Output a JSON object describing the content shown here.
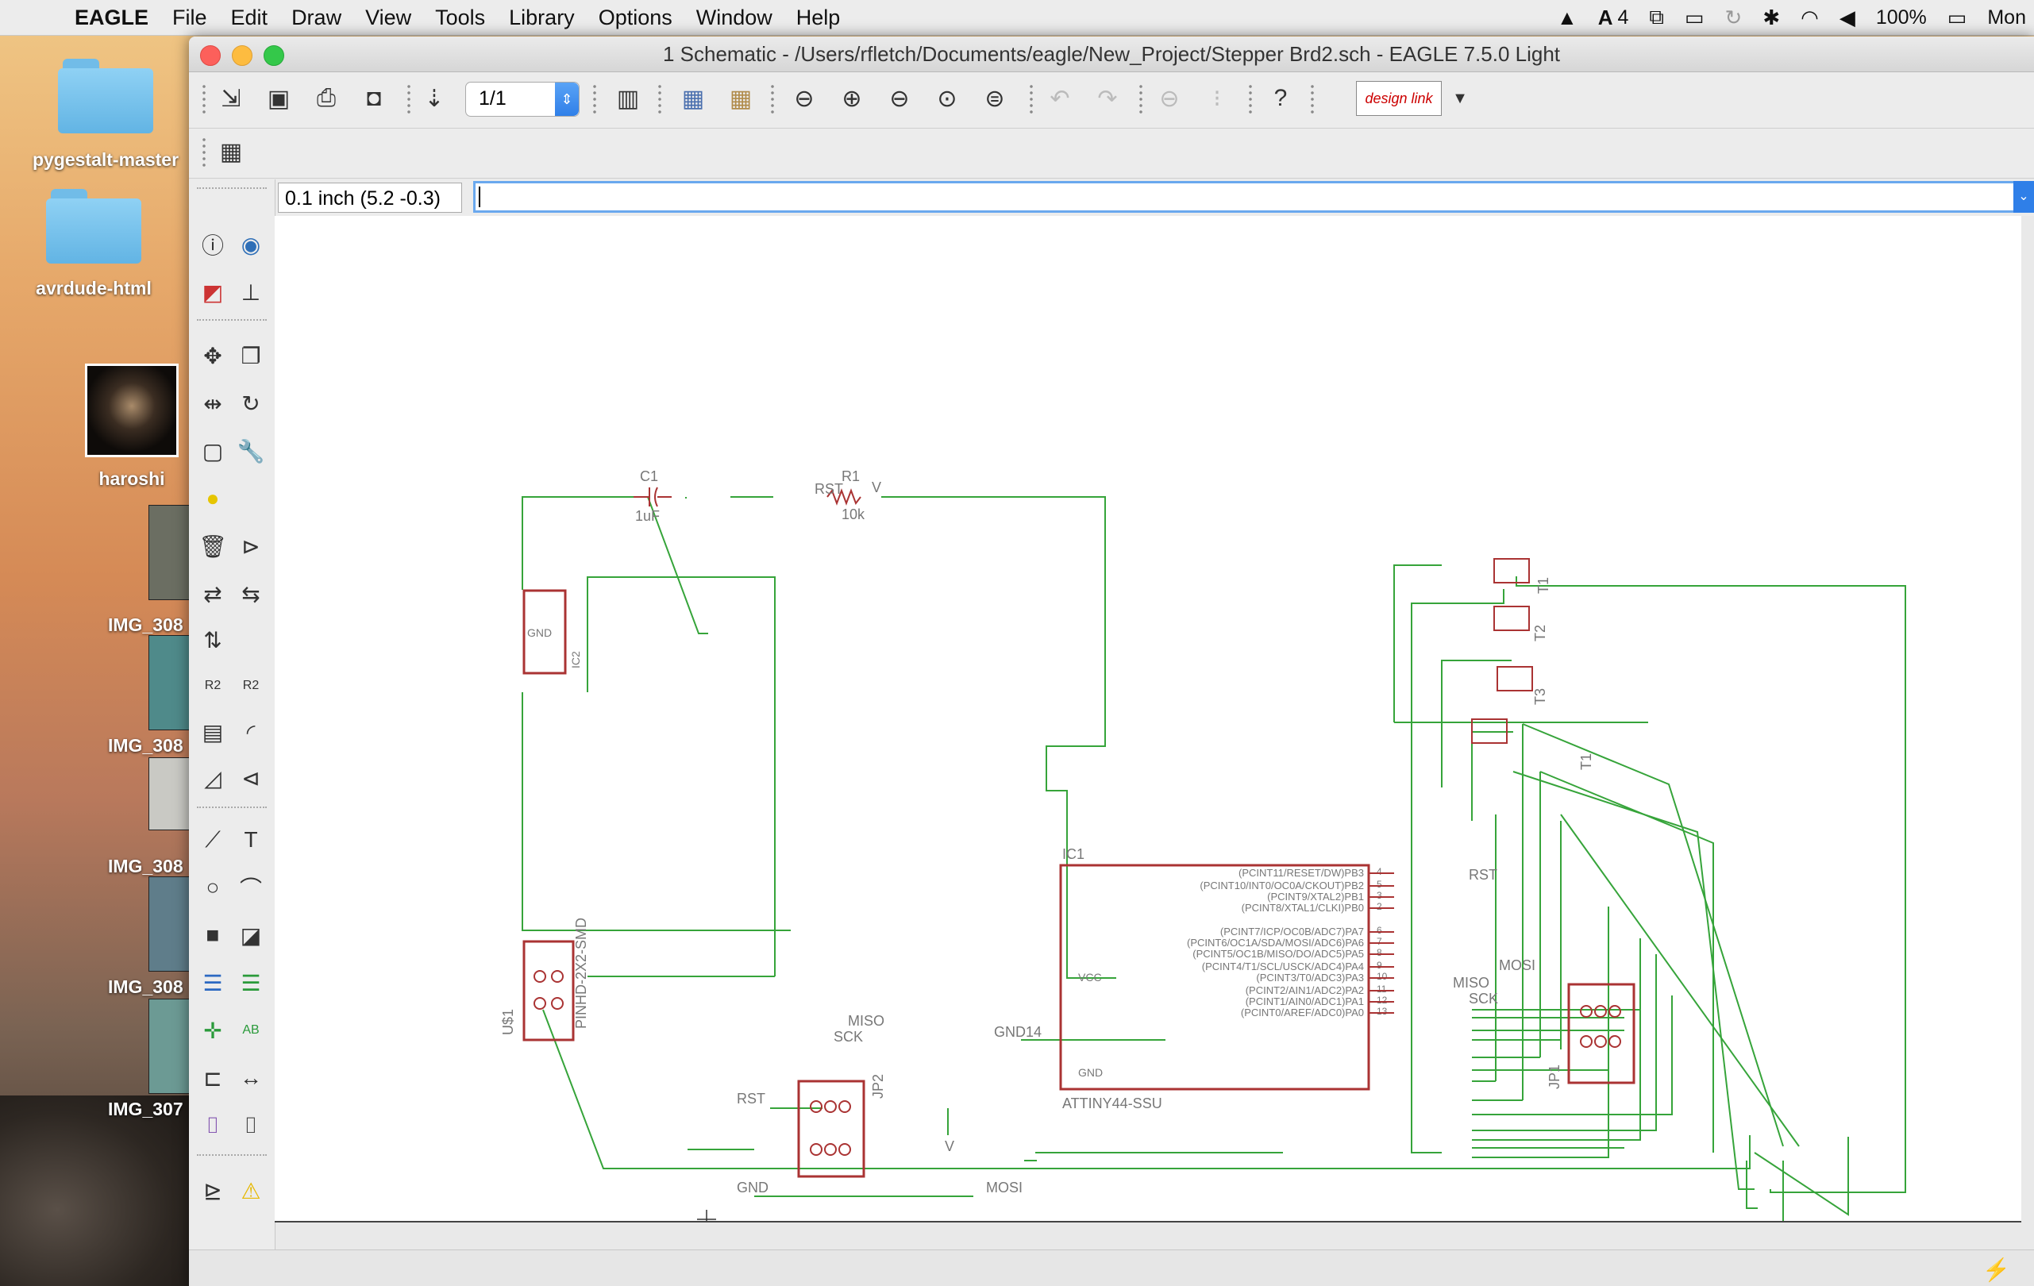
{
  "menubar": {
    "app_name": "EAGLE",
    "items": [
      "File",
      "Edit",
      "Draw",
      "View",
      "Tools",
      "Library",
      "Options",
      "Window",
      "Help"
    ],
    "status": {
      "adobe_count": "4",
      "battery": "100%",
      "clock": "Mon"
    }
  },
  "desktop": {
    "icons": [
      {
        "label": "pygestalt-master"
      },
      {
        "label": "avrdude-html"
      },
      {
        "label": "haroshi"
      }
    ],
    "thumbnails": [
      "IMG_308",
      "IMG_308",
      "IMG_308",
      "IMG_308",
      "IMG_307"
    ]
  },
  "window": {
    "title": "1 Schematic - /Users/rfletch/Documents/eagle/New_Project/Stepper Brd2.sch - EAGLE 7.5.0 Light",
    "sheet_selector": "1/1",
    "design_link_label": "design link",
    "coordinate_readout": "0.1 inch (5.2 -0.3)",
    "command_value": ""
  },
  "schematic": {
    "labels": {
      "c1_name": "C1",
      "c1_value": "1uF",
      "r1_name": "R1",
      "r1_value": "10k",
      "rst_top": "RST",
      "v_top": "V",
      "ic1_name": "IC1",
      "ic1_part": "ATTINY44-SSU",
      "vcc": "VCC",
      "gnd": "GND",
      "gnd14": "GND14",
      "u1": "U$1",
      "pinhd": "PINHD-2X2-SMD",
      "ic2": "IC2",
      "jp2": "JP2",
      "jp1": "JP1",
      "miso": "MISO",
      "sck": "SCK",
      "rst_jp2": "RST",
      "gnd_jp2": "GND",
      "mosi_jp2": "MOSI",
      "v_jp2": "V",
      "rst_right": "RST",
      "mosi_right": "MOSI",
      "miso_right": "MISO",
      "sck_right": "SCK",
      "t1": "T1",
      "t2": "T2",
      "t3": "T3",
      "t1b": "T1"
    },
    "ic1_pins": [
      {
        "name": "(PCINT11/RESET/DW)PB3",
        "num": "4"
      },
      {
        "name": "(PCINT10/INT0/OC0A/CKOUT)PB2",
        "num": "5"
      },
      {
        "name": "(PCINT9/XTAL2)PB1",
        "num": "3"
      },
      {
        "name": "(PCINT8/XTAL1/CLKI)PB0",
        "num": "2"
      },
      {
        "name": "(PCINT7/ICP/OC0B/ADC7)PA7",
        "num": "6"
      },
      {
        "name": "(PCINT6/OC1A/SDA/MOSI/ADC6)PA6",
        "num": "7"
      },
      {
        "name": "(PCINT5/OC1B/MISO/DO/ADC5)PA5",
        "num": "8"
      },
      {
        "name": "(PCINT4/T1/SCL/USCK/ADC4)PA4",
        "num": "9"
      },
      {
        "name": "(PCINT3/T0/ADC3)PA3",
        "num": "10"
      },
      {
        "name": "(PCINT2/AIN1/ADC2)PA2",
        "num": "11"
      },
      {
        "name": "(PCINT1/AIN0/ADC1)PA1",
        "num": "12"
      },
      {
        "name": "(PCINT0/AREF/ADC0)PA0",
        "num": "13"
      }
    ]
  }
}
